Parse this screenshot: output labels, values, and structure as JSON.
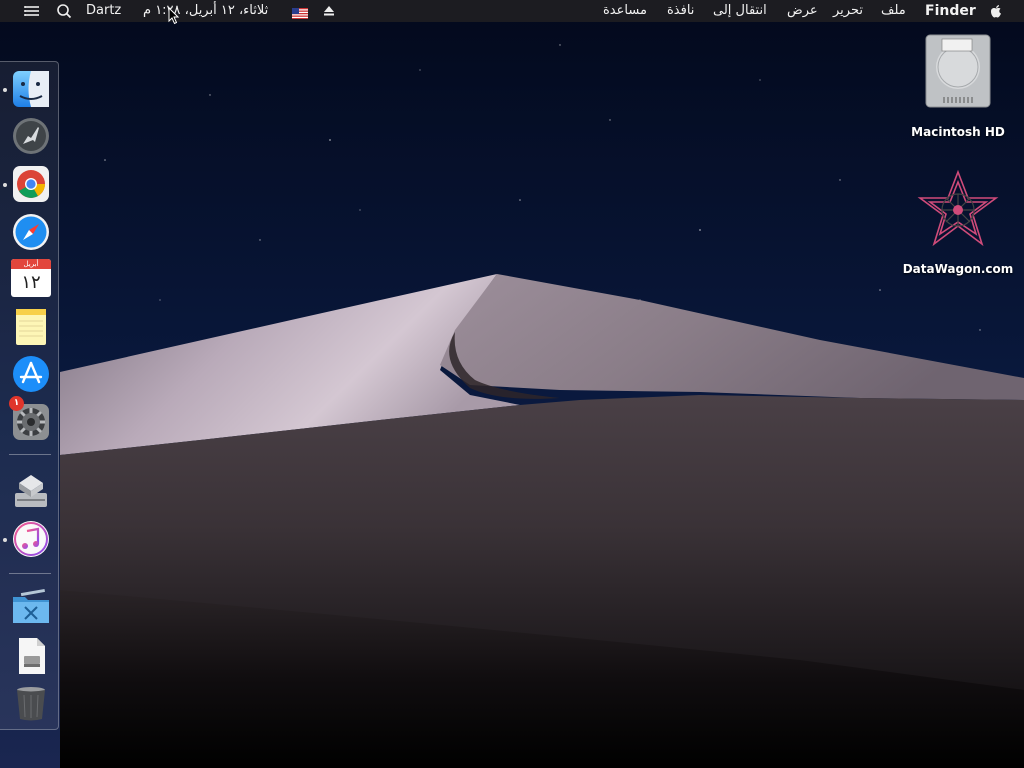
{
  "menubar": {
    "apple_icon": "apple-logo",
    "app_name": "Finder",
    "menus": [
      "ملف",
      "تحرير",
      "عرض",
      "انتقال إلى",
      "نافذة",
      "مساعدة"
    ],
    "eject_icon": "eject-icon",
    "input_source_icon": "us-flag",
    "datetime": "ثلاثاء، ١٢ أبريل، ١:٢٨ م",
    "user": "Dartz",
    "search_icon": "spotlight-search-icon",
    "notifications_icon": "notification-center-icon"
  },
  "dock": {
    "items": [
      {
        "name": "Finder",
        "icon": "finder-icon",
        "running": true
      },
      {
        "name": "Launchpad",
        "icon": "launchpad-icon",
        "running": false
      },
      {
        "name": "Google Chrome",
        "icon": "chrome-icon",
        "running": true
      },
      {
        "name": "Safari",
        "icon": "safari-icon",
        "running": false
      },
      {
        "name": "Calendar",
        "icon": "calendar-icon",
        "running": false,
        "month": "أبريل",
        "day": "١٢"
      },
      {
        "name": "Notes",
        "icon": "notes-icon",
        "running": false
      },
      {
        "name": "App Store",
        "icon": "app-store-icon",
        "running": false
      },
      {
        "name": "System Preferences",
        "icon": "system-preferences-icon",
        "running": false,
        "badge": "١"
      },
      {
        "name": "Boot Camp Assistant",
        "icon": "boot-camp-icon",
        "running": false
      },
      {
        "name": "iTunes",
        "icon": "itunes-icon",
        "running": true
      },
      {
        "name": "Applications",
        "icon": "applications-folder-icon",
        "running": false
      },
      {
        "name": "Document",
        "icon": "document-icon",
        "running": false
      },
      {
        "name": "Trash",
        "icon": "trash-icon",
        "running": false
      }
    ]
  },
  "desktop": {
    "icons": [
      {
        "label": "Macintosh HD",
        "icon": "hard-drive-icon"
      },
      {
        "label": "DataWagon.com",
        "icon": "datawagon-logo-icon"
      }
    ]
  },
  "colors": {
    "sky_top": "#040b20",
    "sky_bottom": "#0c1c44",
    "dune_light": "#c4b6c2",
    "dune_dark": "#3a3236",
    "badge_red": "#e0352b"
  }
}
